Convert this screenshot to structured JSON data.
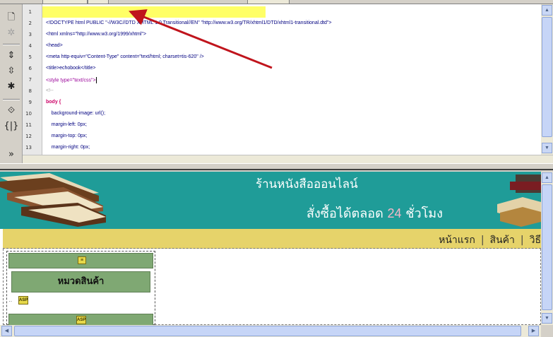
{
  "editor": {
    "lines": [
      {
        "n": "1",
        "text": "",
        "color": "#000000"
      },
      {
        "n": "2",
        "text": "<!DOCTYPE html PUBLIC \"-//W3C//DTD XHTML 1.0 Transitional//EN\" \"http://www.w3.org/TR/xhtml1/DTD/xhtml1-transitional.dtd\">",
        "color": "#000080"
      },
      {
        "n": "3",
        "text": "<html xmlns=\"http://www.w3.org/1999/xhtml\">",
        "color": "#000080"
      },
      {
        "n": "4",
        "text": "<head>",
        "color": "#000080"
      },
      {
        "n": "5",
        "text": "<meta http-equiv=\"Content-Type\" content=\"text/html; charset=tis-620\" />",
        "color": "#000080"
      },
      {
        "n": "6",
        "text": "<title>echobook</title>",
        "color": "#000080"
      },
      {
        "n": "7",
        "text": "<style type=\"text/css\">",
        "color": "#990099"
      },
      {
        "n": "8",
        "text": "<!--",
        "color": "#999999"
      },
      {
        "n": "9",
        "text": "body {",
        "color": "#cc0066"
      },
      {
        "n": "10",
        "text": "    background-image: url();",
        "color": "#000080"
      },
      {
        "n": "11",
        "text": "    margin-left: 0px;",
        "color": "#000080"
      },
      {
        "n": "12",
        "text": "    margin-top: 0px;",
        "color": "#000080"
      },
      {
        "n": "13",
        "text": "    margin-right: 0px;",
        "color": "#000080"
      }
    ]
  },
  "design": {
    "banner_title": "ร้านหนังสือออนไลน์",
    "banner_sub_prefix": "สั่งซื้อได้ตลอด ",
    "banner_sub_number": "24",
    "banner_sub_suffix": " ชั่วโมง",
    "nav": [
      "หน้าแรก",
      "สินค้า",
      "วิธี"
    ],
    "nav_separator": "|",
    "category_title": "หมวดสินค้า",
    "asp_label": "ASP"
  },
  "colors": {
    "banner": "#1f9c98",
    "navbar": "#e6d36a",
    "sidebar_green": "#7fa873",
    "highlight": "#ffff66",
    "arrow": "#c0141c"
  },
  "icons": {
    "toolbar": [
      "open-file-icon",
      "options-icon",
      "collapse-full-tag-icon",
      "collapse-selection-icon",
      "expand-all-icon",
      "select-parent-tag-icon",
      "balance-braces-icon",
      "more-tools-icon"
    ]
  }
}
